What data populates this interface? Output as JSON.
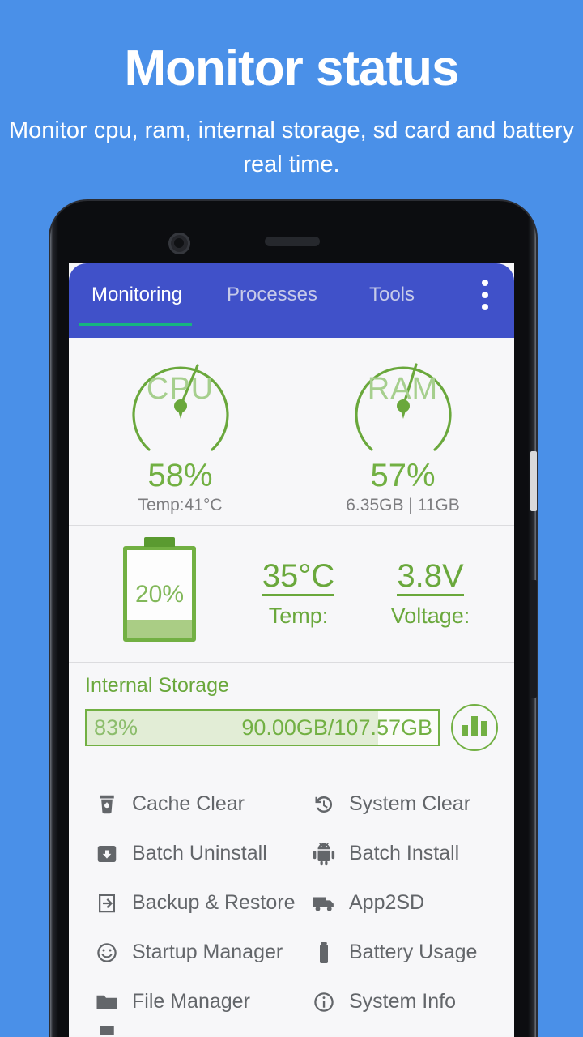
{
  "promo": {
    "title": "Monitor status",
    "subtitle": "Monitor cpu, ram, internal storage, sd card and battery real time."
  },
  "appbar": {
    "tabs": [
      {
        "label": "Monitoring",
        "active": true
      },
      {
        "label": "Processes",
        "active": false
      },
      {
        "label": "Tools",
        "active": false
      }
    ],
    "overflow_icon": "more-vertical-icon",
    "background_color": "#4051c9",
    "active_indicator_color": "#16b47f"
  },
  "monitor": {
    "accent_color": "#72b043",
    "cpu": {
      "label": "CPU",
      "percent": "58%",
      "percent_value": 58,
      "sub": "Temp:41°C"
    },
    "ram": {
      "label": "RAM",
      "percent": "57%",
      "percent_value": 57,
      "sub": "6.35GB | 11GB"
    },
    "battery": {
      "percent": "20%",
      "percent_value": 20,
      "temp_value": "35°C",
      "temp_key": "Temp:",
      "voltage_value": "3.8V",
      "voltage_key": "Voltage:"
    },
    "storage": {
      "title": "Internal Storage",
      "percent": "83%",
      "percent_value": 83,
      "size": "90.00GB/107.57GB",
      "chart_icon": "bar-chart-icon"
    }
  },
  "tools": {
    "rows": [
      [
        {
          "label": "Cache Clear",
          "icon": "cache-clear-icon"
        },
        {
          "label": "System Clear",
          "icon": "history-clock-icon"
        }
      ],
      [
        {
          "label": "Batch Uninstall",
          "icon": "box-down-arrow-icon"
        },
        {
          "label": "Batch Install",
          "icon": "android-robot-icon"
        }
      ],
      [
        {
          "label": "Backup & Restore",
          "icon": "arrow-into-bracket-icon"
        },
        {
          "label": "App2SD",
          "icon": "truck-icon"
        }
      ],
      [
        {
          "label": "Startup Manager",
          "icon": "smiley-face-icon"
        },
        {
          "label": "Battery Usage",
          "icon": "battery-icon"
        }
      ],
      [
        {
          "label": "File Manager",
          "icon": "folder-icon"
        },
        {
          "label": "System Info",
          "icon": "info-circle-icon"
        }
      ]
    ]
  }
}
